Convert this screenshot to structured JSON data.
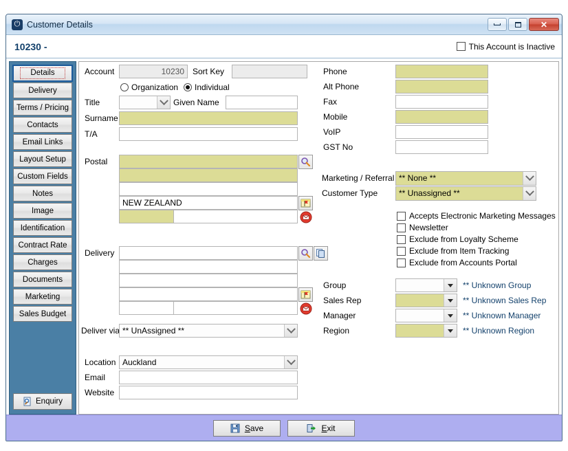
{
  "window": {
    "title": "Customer Details",
    "app_icon": "power-icon",
    "buttons": {
      "minimize": "minimize-icon",
      "maximize": "maximize-icon",
      "close": "✕"
    }
  },
  "header": {
    "account_number": "10230 -",
    "inactive_label": "This Account is Inactive",
    "inactive_checked": false
  },
  "sidebar": {
    "tabs": [
      {
        "label": "Details",
        "active": true
      },
      {
        "label": "Delivery",
        "active": false
      },
      {
        "label": "Terms / Pricing",
        "active": false
      },
      {
        "label": "Contacts",
        "active": false
      },
      {
        "label": "Email Links",
        "active": false
      },
      {
        "label": "Layout Setup",
        "active": false
      },
      {
        "label": "Custom Fields",
        "active": false
      },
      {
        "label": "Notes",
        "active": false
      },
      {
        "label": "Image",
        "active": false
      },
      {
        "label": "Identification",
        "active": false
      },
      {
        "label": "Contract Rate",
        "active": false
      },
      {
        "label": "Charges",
        "active": false
      },
      {
        "label": "Documents",
        "active": false
      },
      {
        "label": "Marketing",
        "active": false
      },
      {
        "label": "Sales Budget",
        "active": false
      }
    ],
    "enquiry_label": "Enquiry"
  },
  "form": {
    "account_label": "Account",
    "account_value": "10230",
    "sort_key_label": "Sort Key",
    "sort_key_value": "",
    "org_label": "Organization",
    "individual_label": "Individual",
    "entity_selected": "Individual",
    "title_label": "Title",
    "title_value": "",
    "given_name_label": "Given Name",
    "given_name_value": "",
    "surname_label": "Surname",
    "surname_value": "",
    "ta_label": "T/A",
    "ta_value": "",
    "postal_label": "Postal",
    "postal_line1": "",
    "postal_line2": "",
    "postal_line3": "",
    "postal_country": "NEW ZEALAND",
    "postal_postcode": "",
    "postal_extra": "",
    "delivery_label": "Delivery",
    "delivery_line1": "",
    "delivery_line2": "",
    "delivery_line3": "",
    "delivery_line4": "",
    "delivery_postcode": "",
    "delivery_extra": "",
    "deliver_via_label": "Deliver via",
    "deliver_via_value": "** UnAssigned **",
    "location_label": "Location",
    "location_value": "Auckland",
    "email_label": "Email",
    "email_value": "",
    "website_label": "Website",
    "website_value": ""
  },
  "contact": {
    "phone_label": "Phone",
    "phone_value": "",
    "alt_phone_label": "Alt Phone",
    "alt_phone_value": "",
    "fax_label": "Fax",
    "fax_value": "",
    "mobile_label": "Mobile",
    "mobile_value": "",
    "voip_label": "VoIP",
    "voip_value": "",
    "gst_label": "GST No",
    "gst_value": ""
  },
  "marketing": {
    "referral_label": "Marketing / Referral",
    "referral_value": "** None **",
    "customer_type_label": "Customer Type",
    "customer_type_value": "** Unassigned **",
    "checkboxes": [
      {
        "label": "Accepts Electronic Marketing Messages",
        "checked": false
      },
      {
        "label": "Newsletter",
        "checked": false
      },
      {
        "label": "Exclude from Loyalty Scheme",
        "checked": false
      },
      {
        "label": "Exclude from Item Tracking",
        "checked": false
      },
      {
        "label": "Exclude from Accounts Portal",
        "checked": false
      }
    ]
  },
  "assignments": [
    {
      "label": "Group",
      "value": "",
      "note": "** Unknown Group",
      "required": false
    },
    {
      "label": "Sales Rep",
      "value": "",
      "note": "** Unknown Sales Rep",
      "required": true
    },
    {
      "label": "Manager",
      "value": "",
      "note": "** Unknown Manager",
      "required": false
    },
    {
      "label": "Region",
      "value": "",
      "note": "** Unknown Region",
      "required": true
    }
  ],
  "footer": {
    "save_label": "Save",
    "save_accel": "S",
    "exit_label": "Exit",
    "exit_accel": "E"
  },
  "colors": {
    "sidebar": "#4a7fa5",
    "required_field": "#dcdc96",
    "footer": "#aeaef0",
    "accent_title": "#12406b"
  }
}
